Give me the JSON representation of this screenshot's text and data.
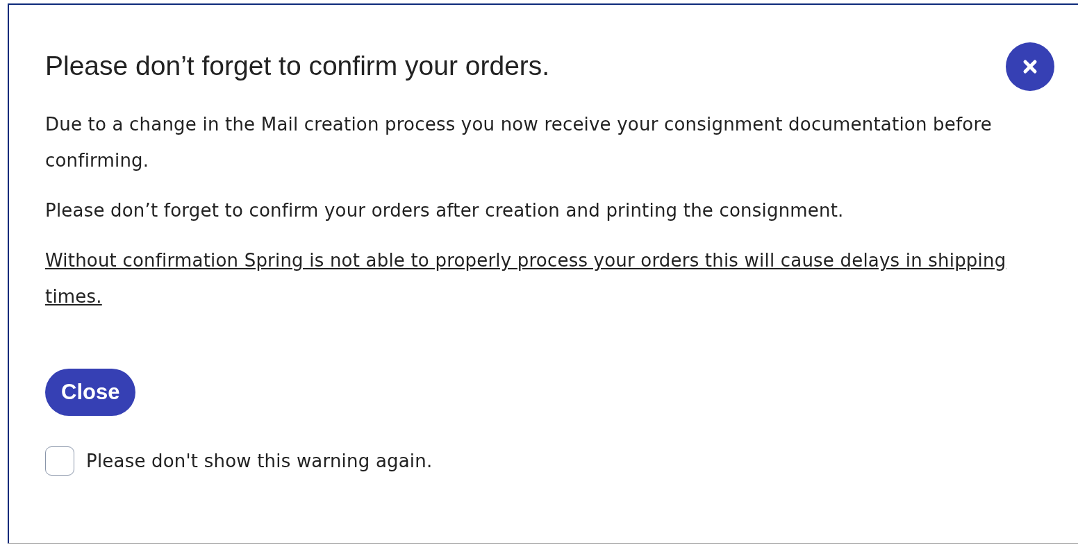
{
  "dialog": {
    "title": "Please don’t forget to confirm your orders.",
    "paragraphs": [
      {
        "kind": "plain",
        "text": "Due to a change in the Mail creation process you now receive your consignment documentation before confirming."
      },
      {
        "kind": "plain",
        "text": "Please don’t forget to confirm your orders after creation and printing the consignment."
      },
      {
        "kind": "underlined",
        "text": "Without confirmation Spring is not able to properly process your orders this will cause delays in shipping times."
      }
    ],
    "button": "Close",
    "checkbox": {
      "label": "Please don't show this warning again.",
      "checked": false
    }
  }
}
